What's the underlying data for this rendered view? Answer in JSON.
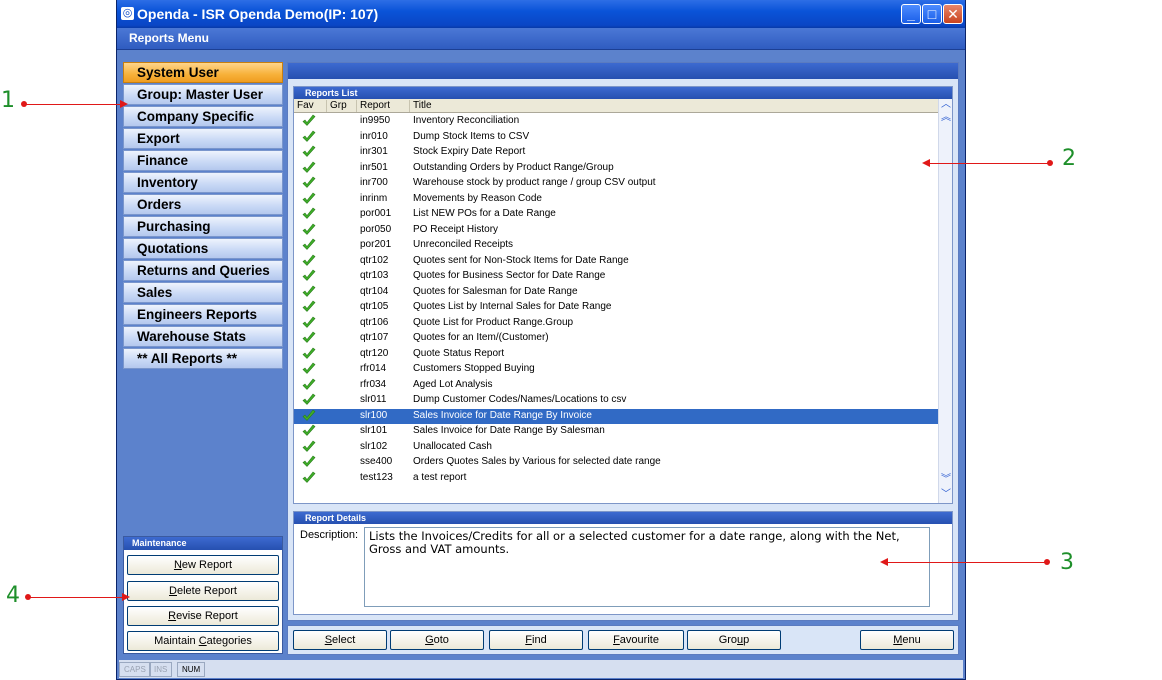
{
  "window": {
    "title": "Openda  -  ISR Openda Demo(IP: 107)",
    "menu_title": "Reports Menu"
  },
  "sidebar": {
    "categories": [
      {
        "label": "System User",
        "active": true
      },
      {
        "label": "Group: Master User"
      },
      {
        "label": "Company Specific"
      },
      {
        "label": "Export"
      },
      {
        "label": "Finance"
      },
      {
        "label": "Inventory"
      },
      {
        "label": "Orders"
      },
      {
        "label": "Purchasing"
      },
      {
        "label": "Quotations"
      },
      {
        "label": "Returns and Queries"
      },
      {
        "label": "Sales"
      },
      {
        "label": "Engineers Reports"
      },
      {
        "label": "Warehouse Stats"
      },
      {
        "label": "** All Reports **"
      }
    ]
  },
  "maintenance": {
    "header": "Maintenance",
    "new_report": "New Report",
    "delete_report": "Delete Report",
    "revise_report": "Revise Report",
    "maintain_categories": "Maintain Categories"
  },
  "reports_list": {
    "header": "Reports List",
    "columns": {
      "fav": "Fav",
      "grp": "Grp",
      "report": "Report",
      "title": "Title"
    },
    "selected_index": 19,
    "rows": [
      {
        "code": "in9950",
        "title": "Inventory Reconciliation"
      },
      {
        "code": "inr010",
        "title": "Dump Stock Items to CSV"
      },
      {
        "code": "inr301",
        "title": "Stock Expiry Date Report"
      },
      {
        "code": "inr501",
        "title": "Outstanding Orders by Product Range/Group"
      },
      {
        "code": "inr700",
        "title": "Warehouse stock by product range / group CSV output"
      },
      {
        "code": "inrinm",
        "title": "Movements by Reason Code"
      },
      {
        "code": "por001",
        "title": "List NEW POs for a Date Range"
      },
      {
        "code": "por050",
        "title": "PO Receipt History"
      },
      {
        "code": "por201",
        "title": "Unreconciled Receipts"
      },
      {
        "code": "qtr102",
        "title": "Quotes sent for Non-Stock Items for Date Range"
      },
      {
        "code": "qtr103",
        "title": "Quotes for Business Sector for Date Range"
      },
      {
        "code": "qtr104",
        "title": "Quotes for Salesman for Date Range"
      },
      {
        "code": "qtr105",
        "title": "Quotes List by Internal Sales for Date Range"
      },
      {
        "code": "qtr106",
        "title": "Quote List for Product Range.Group"
      },
      {
        "code": "qtr107",
        "title": "Quotes for an Item/(Customer)"
      },
      {
        "code": "qtr120",
        "title": "Quote Status Report"
      },
      {
        "code": "rfr014",
        "title": "Customers Stopped Buying"
      },
      {
        "code": "rfr034",
        "title": "Aged Lot Analysis"
      },
      {
        "code": "slr011",
        "title": "Dump Customer Codes/Names/Locations to csv"
      },
      {
        "code": "slr100",
        "title": "Sales Invoice for Date Range By Invoice"
      },
      {
        "code": "slr101",
        "title": "Sales Invoice for Date Range By Salesman"
      },
      {
        "code": "slr102",
        "title": "Unallocated Cash"
      },
      {
        "code": "sse400",
        "title": "Orders Quotes Sales by Various for selected date range"
      },
      {
        "code": "test123",
        "title": "a test report"
      }
    ]
  },
  "report_details": {
    "header": "Report Details",
    "description_label": "Description:",
    "description": "Lists the Invoices/Credits for all or a selected customer for a date range, along with the Net, Gross and VAT amounts."
  },
  "buttons": {
    "select": "Select",
    "goto": "Goto",
    "find": "Find",
    "favourite": "Favourite",
    "group": "Group",
    "menu": "Menu"
  },
  "status": {
    "caps": "CAPS",
    "ins": "INS",
    "num": "NUM"
  },
  "callouts": {
    "one": "1",
    "two": "2",
    "three": "3",
    "four": "4"
  },
  "colors": {
    "accent": "#2650b0",
    "selected_row": "#316ac5",
    "active_category": "#f7b13a",
    "callout_text": "#1e8f2a",
    "callout_arrow": "#e01818"
  }
}
